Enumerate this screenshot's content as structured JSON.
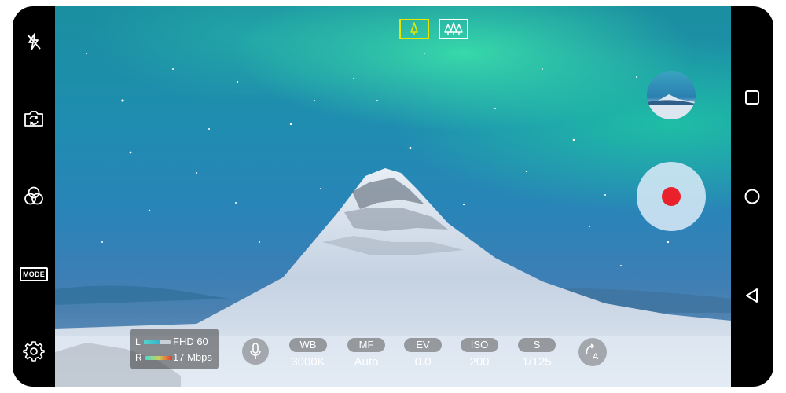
{
  "left_bar": {
    "flash_icon": "flash-off-icon",
    "switch_icon": "camera-switch-icon",
    "filter_icon": "filter-icon",
    "mode_label": "MODE",
    "settings_icon": "gear-icon"
  },
  "lens_selector": {
    "items": [
      {
        "icon": "single-tree-icon",
        "active": true
      },
      {
        "icon": "wide-trees-icon",
        "active": false
      }
    ],
    "active_color": "#e6e600"
  },
  "recording_info": {
    "left_channel": "L",
    "right_channel": "R",
    "resolution": "FHD 60",
    "bitrate": "17 Mbps"
  },
  "mic_icon": "microphone-icon",
  "params": [
    {
      "label": "WB",
      "value": "3000K"
    },
    {
      "label": "MF",
      "value": "Auto"
    },
    {
      "label": "EV",
      "value": "0.0"
    },
    {
      "label": "ISO",
      "value": "200"
    },
    {
      "label": "S",
      "value": "1/125"
    }
  ],
  "auto_reset_label": "A",
  "record_color": "#e8212b",
  "nav": {
    "recents_icon": "square-icon",
    "home_icon": "circle-icon",
    "back_icon": "triangle-back-icon"
  }
}
